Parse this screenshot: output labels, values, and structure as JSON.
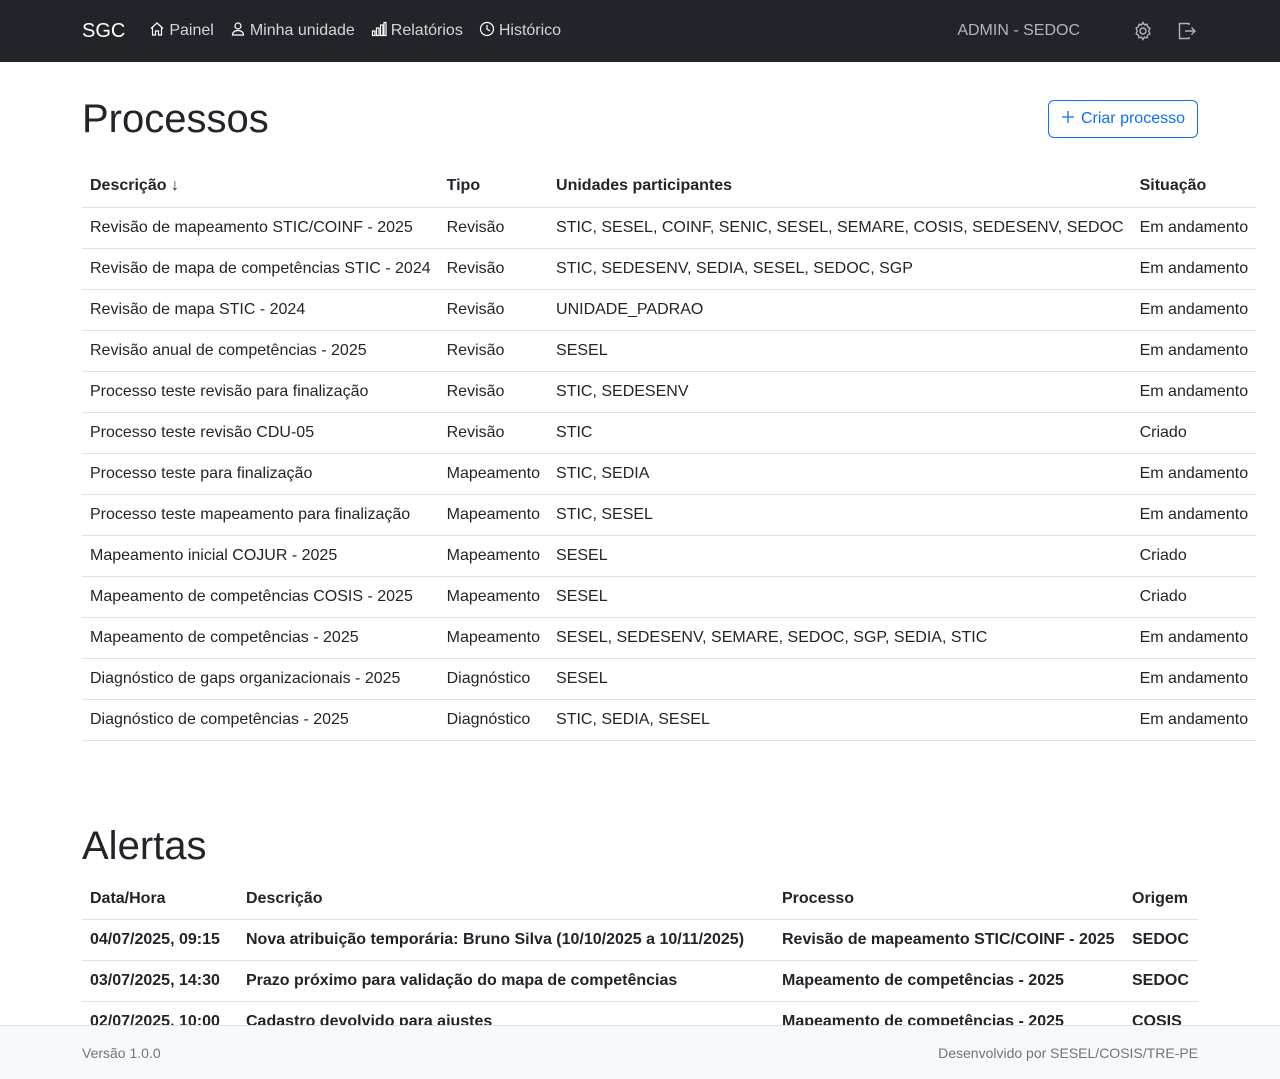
{
  "nav": {
    "brand": "SGC",
    "links": [
      {
        "label": "Painel",
        "icon": "house-icon"
      },
      {
        "label": "Minha unidade",
        "icon": "person-icon"
      },
      {
        "label": "Relatórios",
        "icon": "bar-chart-icon"
      },
      {
        "label": "Histórico",
        "icon": "clock-icon"
      }
    ],
    "user": "ADMIN - SEDOC",
    "settings_icon": "gear-icon",
    "logout_icon": "logout-icon"
  },
  "processos": {
    "title": "Processos",
    "create_button": "Criar processo",
    "columns": [
      "Descrição ↓",
      "Tipo",
      "Unidades participantes",
      "Situação"
    ],
    "rows": [
      [
        "Revisão de mapeamento STIC/COINF - 2025",
        "Revisão",
        "STIC, SESEL, COINF, SENIC, SESEL, SEMARE, COSIS, SEDESENV, SEDOC",
        "Em andamento"
      ],
      [
        "Revisão de mapa de competências STIC - 2024",
        "Revisão",
        "STIC, SEDESENV, SEDIA, SESEL, SEDOC, SGP",
        "Em andamento"
      ],
      [
        "Revisão de mapa STIC - 2024",
        "Revisão",
        "UNIDADE_PADRAO",
        "Em andamento"
      ],
      [
        "Revisão anual de competências - 2025",
        "Revisão",
        "SESEL",
        "Em andamento"
      ],
      [
        "Processo teste revisão para finalização",
        "Revisão",
        "STIC, SEDESENV",
        "Em andamento"
      ],
      [
        "Processo teste revisão CDU-05",
        "Revisão",
        "STIC",
        "Criado"
      ],
      [
        "Processo teste para finalização",
        "Mapeamento",
        "STIC, SEDIA",
        "Em andamento"
      ],
      [
        "Processo teste mapeamento para finalização",
        "Mapeamento",
        "STIC, SESEL",
        "Em andamento"
      ],
      [
        "Mapeamento inicial COJUR - 2025",
        "Mapeamento",
        "SESEL",
        "Criado"
      ],
      [
        "Mapeamento de competências COSIS - 2025",
        "Mapeamento",
        "SESEL",
        "Criado"
      ],
      [
        "Mapeamento de competências - 2025",
        "Mapeamento",
        "SESEL, SEDESENV, SEMARE, SEDOC, SGP, SEDIA, STIC",
        "Em andamento"
      ],
      [
        "Diagnóstico de gaps organizacionais - 2025",
        "Diagnóstico",
        "SESEL",
        "Em andamento"
      ],
      [
        "Diagnóstico de competências - 2025",
        "Diagnóstico",
        "STIC, SEDIA, SESEL",
        "Em andamento"
      ]
    ]
  },
  "alertas": {
    "title": "Alertas",
    "columns": [
      "Data/Hora",
      "Descrição",
      "Processo",
      "Origem"
    ],
    "rows": [
      [
        "04/07/2025, 09:15",
        "Nova atribuição temporária: Bruno Silva (10/10/2025 a 10/11/2025)",
        "Revisão de mapeamento STIC/COINF - 2025",
        "SEDOC"
      ],
      [
        "03/07/2025, 14:30",
        "Prazo próximo para validação do mapa de competências",
        "Mapeamento de competências - 2025",
        "SEDOC"
      ],
      [
        "02/07/2025, 10:00",
        "Cadastro devolvido para ajustes",
        "Mapeamento de competências - 2025",
        "COSIS"
      ]
    ]
  },
  "footer": {
    "version": "Versão 1.0.0",
    "credit": "Desenvolvido por SESEL/COSIS/TRE-PE"
  }
}
